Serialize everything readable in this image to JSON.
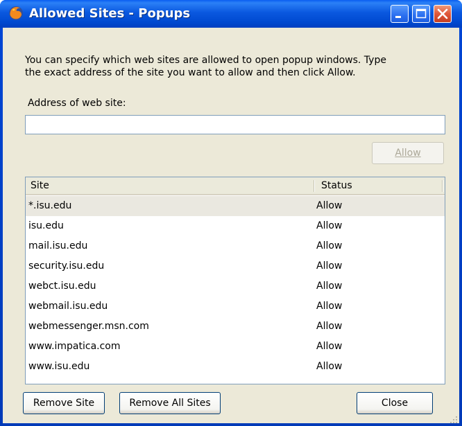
{
  "window": {
    "title": "Allowed Sites - Popups",
    "app_icon": "firefox-icon",
    "controls": [
      "minimize-icon",
      "maximize-icon",
      "close-icon"
    ]
  },
  "description": {
    "line1": "You can specify which web sites are allowed to open popup windows. Type",
    "line2": "the exact address of the site you want to allow and then click Allow."
  },
  "address": {
    "label": "Address of web site:",
    "value": ""
  },
  "allow_button": {
    "label": "Allow",
    "enabled": false
  },
  "table": {
    "columns": [
      "Site",
      "Status"
    ],
    "rows": [
      {
        "site": "*.isu.edu",
        "status": "Allow",
        "selected": true
      },
      {
        "site": "isu.edu",
        "status": "Allow"
      },
      {
        "site": "mail.isu.edu",
        "status": "Allow"
      },
      {
        "site": "security.isu.edu",
        "status": "Allow"
      },
      {
        "site": "webct.isu.edu",
        "status": "Allow"
      },
      {
        "site": "webmail.isu.edu",
        "status": "Allow"
      },
      {
        "site": "webmessenger.msn.com",
        "status": "Allow"
      },
      {
        "site": "www.impatica.com",
        "status": "Allow"
      },
      {
        "site": "www.isu.edu",
        "status": "Allow"
      }
    ]
  },
  "buttons": {
    "remove_site": "Remove Site",
    "remove_all": "Remove All Sites",
    "close": "Close"
  }
}
